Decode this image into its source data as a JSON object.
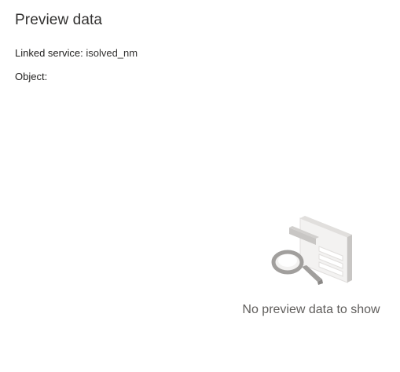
{
  "header": {
    "title": "Preview data"
  },
  "details": {
    "linked_service_label": "Linked service:",
    "linked_service_value": "isolved_nm",
    "object_label": "Object:",
    "object_value": ""
  },
  "empty_state": {
    "message": "No preview data to show",
    "icon": "magnifier-over-table-icon"
  },
  "colors": {
    "text_primary": "#323130",
    "text_secondary": "#605e5c",
    "illustration_light": "#e1dfdd",
    "illustration_mid": "#c8c6c4",
    "illustration_dark": "#a19f9d"
  }
}
